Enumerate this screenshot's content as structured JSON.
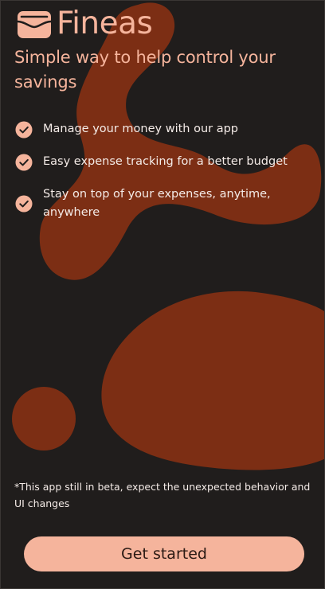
{
  "brand": {
    "name": "Fineas",
    "logo_icon": "wallet-icon"
  },
  "tagline": "Simple way to help control your savings",
  "features": [
    {
      "icon": "check-circle-icon",
      "text": "Manage your money with our app"
    },
    {
      "icon": "check-circle-icon",
      "text": "Easy expense tracking for a better budget"
    },
    {
      "icon": "check-circle-icon",
      "text": "Stay on top of your expenses, anytime, anywhere"
    }
  ],
  "beta_note": "*This app still in beta, expect the unexpected behavior and UI changes",
  "cta": {
    "label": "Get started"
  },
  "colors": {
    "background": "#201d1c",
    "blob": "#7c2e14",
    "accent": "#f5b49c",
    "text": "#f4ebe7"
  }
}
